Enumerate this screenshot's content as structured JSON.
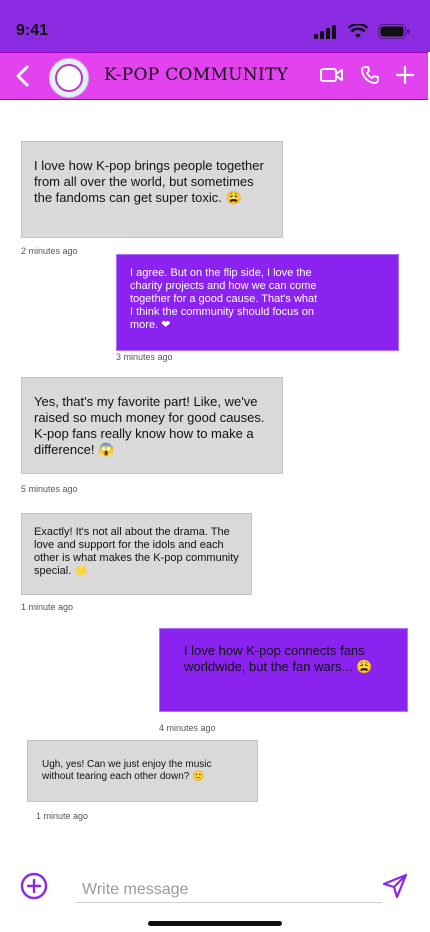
{
  "status": {
    "time": "9:41"
  },
  "header": {
    "title": "K-POP COMMUNITY"
  },
  "messages": [
    {
      "text": "I love how K-pop brings people together from all over the world, but sometimes the fandoms can get super toxic. 😩",
      "time": "2 minutes ago"
    },
    {
      "text": "I agree. But on the flip side, I love the charity projects and how we can come together for a good cause. That's what I think the community should focus on more. ❤",
      "time": "3 minutes ago"
    },
    {
      "text": "Yes, that's my favorite part! Like, we've raised so much money for good causes. K-pop fans really know how to make a difference! 😱",
      "time": "5 minutes ago"
    },
    {
      "text": "Exactly! It's not all about the drama. The love and support for the idols and each other is what makes the K-pop community special. 🌟",
      "time": "1 minute ago"
    },
    {
      "text": "I love how K-pop connects fans worldwide, but the fan wars... 😩",
      "time": "4 minutes ago"
    },
    {
      "text": "Ugh, yes! Can we just enjoy the music without tearing each other down? 🙁",
      "time": "1 minute ago"
    }
  ],
  "composer": {
    "placeholder": "Write message"
  }
}
